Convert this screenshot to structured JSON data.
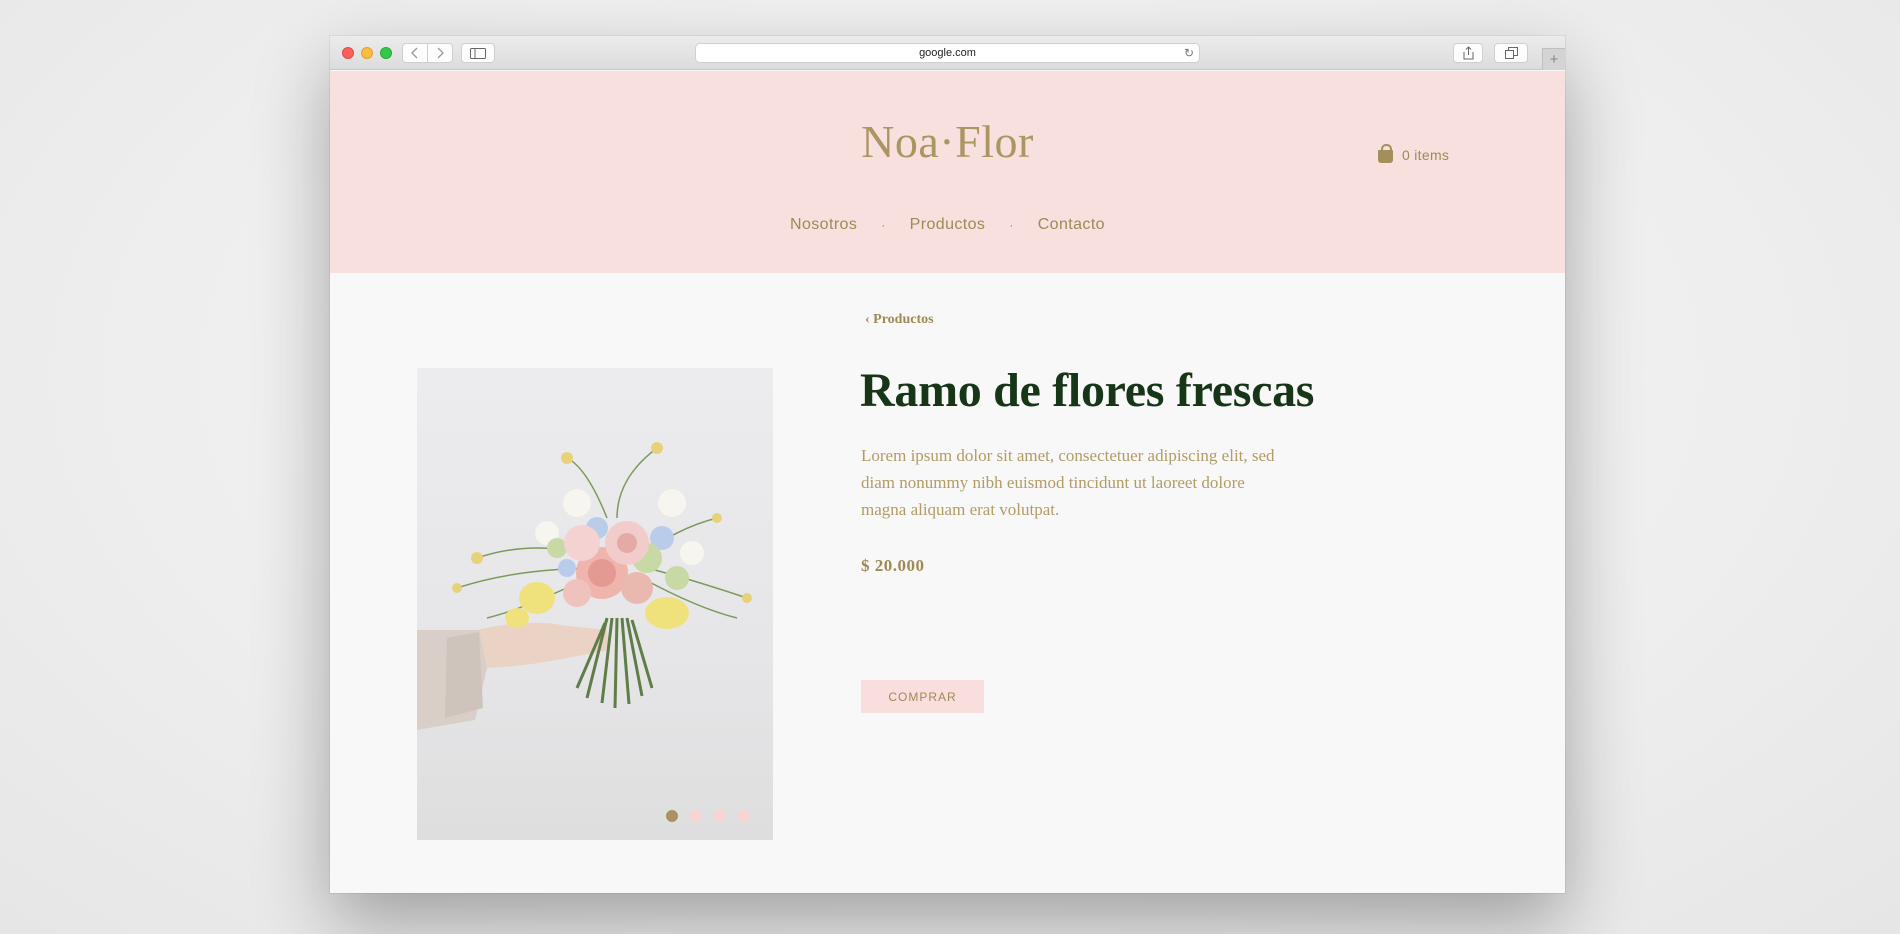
{
  "browser": {
    "url": "google.com"
  },
  "site": {
    "logo": "Noa·Flor",
    "cart_label": "0 items",
    "nav": [
      {
        "label": "Nosotros"
      },
      {
        "label": "Productos"
      },
      {
        "label": "Contacto"
      }
    ],
    "nav_separator": "·"
  },
  "product": {
    "back_link": "‹ Productos",
    "title": "Ramo de flores frescas",
    "description": "Lorem ipsum dolor sit amet, consectetuer adipiscing elit, sed diam nonummy nibh euismod tincidunt ut laoreet dolore magna aliquam erat volutpat.",
    "price": "$ 20.000",
    "buy_label": "COMPRAR",
    "gallery": {
      "total_images": 4,
      "active_index": 0
    }
  },
  "colors": {
    "header_bg": "#f8e0df",
    "accent_gold": "#9e8a55",
    "title_green": "#173617",
    "dot_active": "#a89363",
    "dot_inactive": "#f6d4d3"
  },
  "icons": {
    "cart": "shopping-bag-icon",
    "back": "chevron-left-icon",
    "forward": "chevron-right-icon",
    "sidebar": "sidebar-icon",
    "share": "share-icon",
    "tabs": "tabs-icon",
    "new_tab": "plus-icon",
    "reload": "reload-icon"
  }
}
